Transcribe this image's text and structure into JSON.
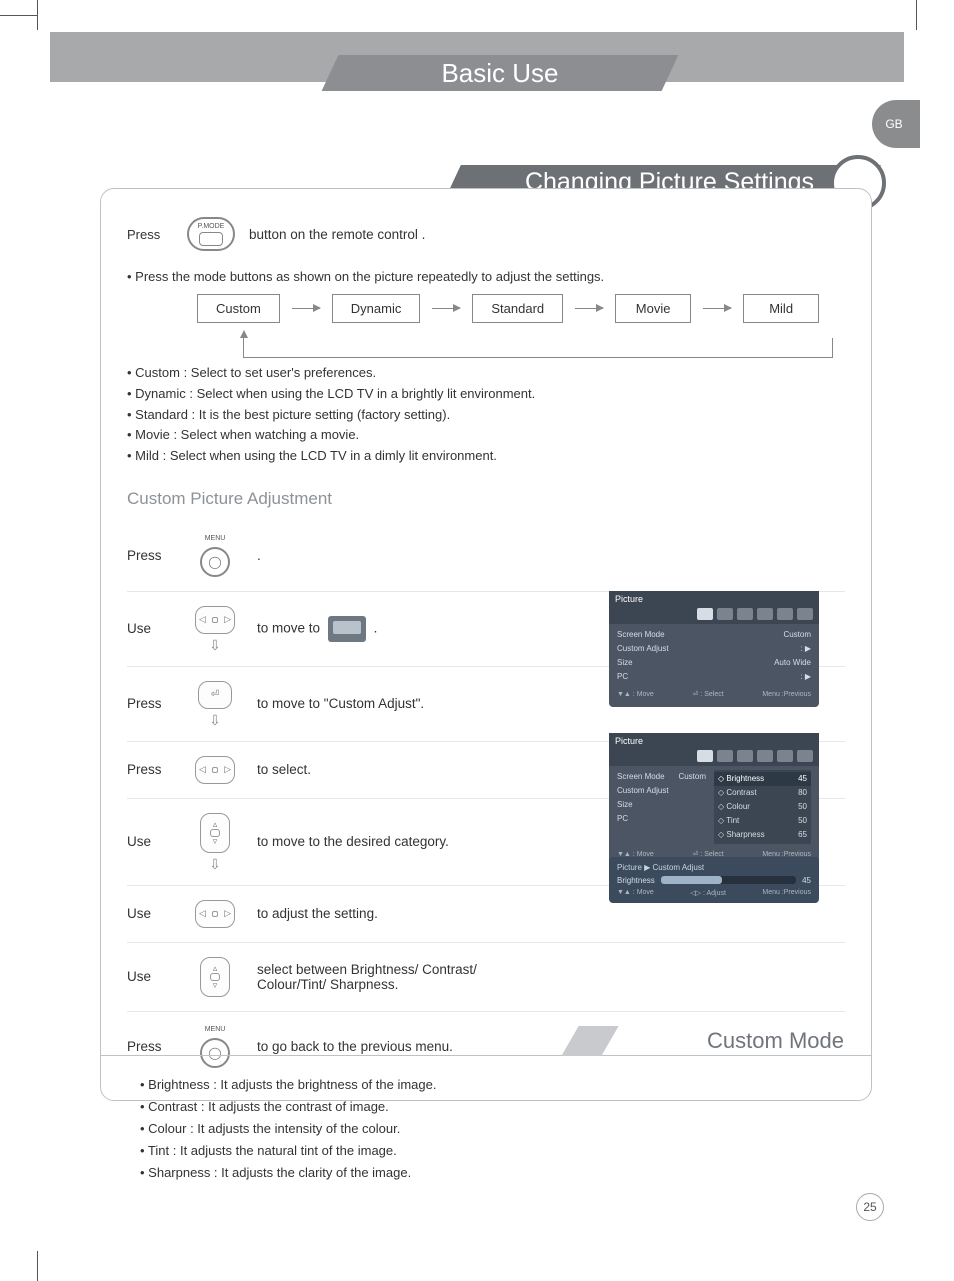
{
  "header": {
    "tab_title": "Basic Use"
  },
  "lang_tab": "GB",
  "section_title": "Changing Picture Settings",
  "intro": {
    "press": "Press",
    "pmode_label": "P.MODE",
    "press_suffix": "button on the remote control .",
    "mode_note": "• Press the mode buttons as shown on the picture repeatedly to adjust the settings."
  },
  "modes": [
    "Custom",
    "Dynamic",
    "Standard",
    "Movie",
    "Mild"
  ],
  "mode_desc": [
    "• Custom : Select to set user's preferences.",
    "• Dynamic : Select when using the LCD TV in a brightly lit environment.",
    "• Standard : It is the best picture setting (factory setting).",
    "• Movie : Select when watching a movie.",
    "• Mild : Select when using the LCD TV in a dimly lit environment."
  ],
  "sub_heading": "Custom Picture Adjustment",
  "steps": [
    {
      "verb": "Press",
      "icon": "menu",
      "text": "."
    },
    {
      "verb": "Use",
      "icon": "lr",
      "arrow": true,
      "text_pre": "to move to",
      "text_post": ".",
      "tv": true
    },
    {
      "verb": "Press",
      "icon": "enter",
      "arrow": true,
      "text": "to move to \"Custom Adjust\"."
    },
    {
      "verb": "Press",
      "icon": "lr",
      "text": "to select."
    },
    {
      "verb": "Use",
      "icon": "ud",
      "arrow": true,
      "text": "to  move to the desired category."
    },
    {
      "verb": "Use",
      "icon": "lr",
      "text": "to adjust the setting."
    },
    {
      "verb": "Use",
      "icon": "ud",
      "text": "select between Brightness/ Contrast/ Colour/Tint/ Sharpness."
    },
    {
      "verb": "Press",
      "icon": "menu",
      "text": "to go back to the previous menu."
    }
  ],
  "osd1": {
    "title": "Picture",
    "rows": [
      [
        "Screen Mode",
        "Custom"
      ],
      [
        "Custom Adjust",
        ": ▶"
      ],
      [
        "Size",
        "Auto Wide"
      ],
      [
        "PC",
        ": ▶"
      ]
    ],
    "foot": [
      "▼▲ : Move",
      "⏎ : Select",
      "Menu :Previous"
    ]
  },
  "osd2": {
    "title": "Picture",
    "rows": [
      [
        "Screen Mode",
        "Custom"
      ],
      [
        "Custom Adjust",
        "",
        true
      ],
      [
        "Size",
        ""
      ],
      [
        "PC",
        ""
      ]
    ],
    "sub": [
      [
        "◇ Brightness",
        "45",
        true
      ],
      [
        "◇ Contrast",
        "80"
      ],
      [
        "◇ Colour",
        "50"
      ],
      [
        "◇ Tint",
        "50"
      ],
      [
        "◇ Sharpness",
        "65"
      ]
    ],
    "foot": [
      "▼▲ : Move",
      "⏎ : Select",
      "Menu :Previous"
    ]
  },
  "osd3": {
    "crumb": "Picture ▶ Custom Adjust",
    "label": "Brightness",
    "value": "45",
    "foot": [
      "▼▲ : Move",
      "◁▷ : Adjust",
      "Menu :Previous"
    ]
  },
  "bottom_title": "Custom Mode",
  "bottom_list": [
    "• Brightness : It adjusts the brightness of the image.",
    "• Contrast : It adjusts the contrast of image.",
    "• Colour : It adjusts the intensity of the colour.",
    "• Tint : It adjusts the natural tint of the image.",
    "• Sharpness : It adjusts the clarity of the image."
  ],
  "page_number": "25",
  "menu_label": "MENU"
}
